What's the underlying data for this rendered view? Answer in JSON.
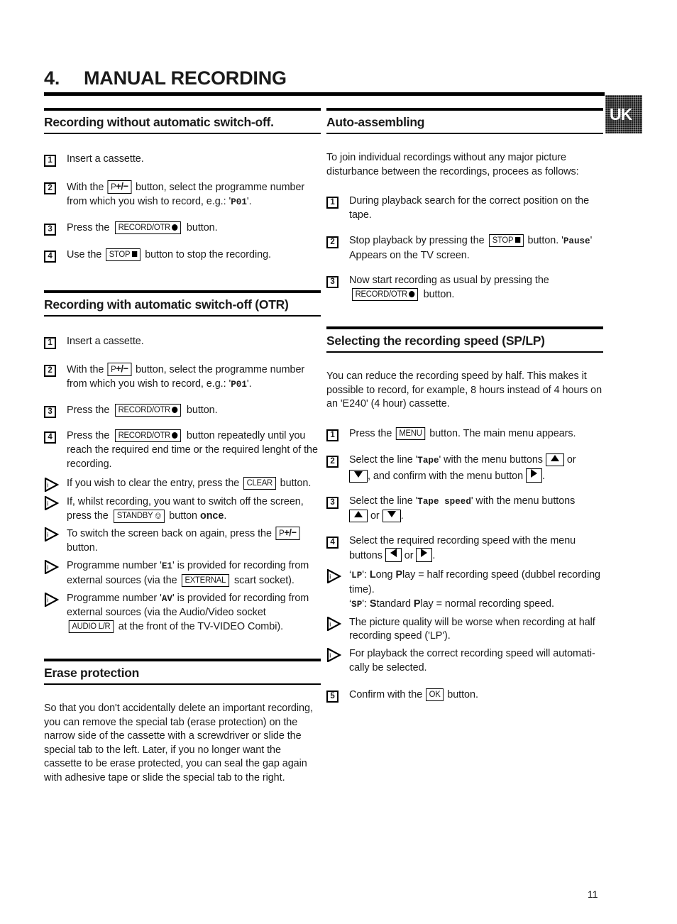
{
  "chapter": {
    "number": "4.",
    "title": "MANUAL RECORDING"
  },
  "badge": {
    "label": "UK"
  },
  "page_number": "11",
  "left_column": {
    "sections": [
      {
        "title": "Recording without automatic switch-off.",
        "steps": [
          {
            "marker": "1",
            "text": "Insert a cassette."
          },
          {
            "marker": "2",
            "text": "With the [P+/−] button, select the programme number from which you wish to record, e.g.: 'P01'."
          },
          {
            "marker": "3",
            "text": "Press the [RECORD/OTR ●] button."
          },
          {
            "marker": "4",
            "text": "Use the [STOP ■] button to stop the recording."
          }
        ]
      },
      {
        "title": "Recording with automatic switch-off (OTR)",
        "steps": [
          {
            "marker": "1",
            "text": "Insert a cassette."
          },
          {
            "marker": "2",
            "text": "With the [P+/−] button, select the programme number from which you wish to record, e.g.: 'P01'."
          },
          {
            "marker": "3",
            "text": "Press the [RECORD/OTR ●] button."
          },
          {
            "marker": "4",
            "text": "Press the [RECORD/OTR ●] button repeatedly until you reach the required end time or the required lenght of the recording."
          },
          {
            "marker": "info",
            "text": "If you wish to clear the entry, press the [CLEAR] button."
          },
          {
            "marker": "info",
            "text": "If, whilst recording, you want to switch off the screen, press the [STANDBY ⏻] button once ."
          },
          {
            "marker": "info",
            "text": "To switch the screen back on again, press the [P+/−] button."
          },
          {
            "marker": "info",
            "text": "Programme number 'E1' is provided for recording from external sources (via the [EXTERNAL] scart socket)."
          },
          {
            "marker": "info",
            "text": "Programme number 'AV' is provided for recording from external sources (via the Audio/Video socket [AUDIO L/R] at the front of the TV-VIDEO Combi)."
          }
        ]
      },
      {
        "title": "Erase protection",
        "paragraph": "So that you don't accidentally delete an important recording, you can remove the special tab (erase protection) on the narrow side of the cassette with a screwdriver or slide the special tab to the left. Later, if you no longer want the cassette to be erase protected, you can seal the gap again with adhesive tape or slide the special tab to the right."
      }
    ]
  },
  "right_column": {
    "sections": [
      {
        "title": "Auto-assembling",
        "paragraph": "To join individual recordings without any major picture disturbance between the recordings, procees as follows:",
        "steps": [
          {
            "marker": "1",
            "text": "During playback search for the correct position on the tape."
          },
          {
            "marker": "2",
            "text": "Stop playback by pressing the [STOP ■] button. 'Pause' Appears on the TV screen."
          },
          {
            "marker": "3",
            "text": "Now start recording as usual by pressing the [RECORD/OTR ●] button."
          }
        ]
      },
      {
        "title": "Selecting the recording speed (SP/LP)",
        "paragraph": "You can reduce the recording speed by half. This makes it possible to record, for example, 8 hours instead of 4 hours on an 'E240' (4 hour) cassette.",
        "steps": [
          {
            "marker": "1",
            "text": "Press the [MENU] button. The main menu appears."
          },
          {
            "marker": "2",
            "text": "Select the line 'Tape' with the menu buttons [▲] or [▼] , and confirm with the menu button [▶] ."
          },
          {
            "marker": "3",
            "text": "Select the line 'Tape speed' with the menu buttons [▲] or [▼] ."
          },
          {
            "marker": "4",
            "text": "Select the required recording speed with the menu buttons [◀] or [▶] ."
          },
          {
            "marker": "info",
            "text": "'LP': Long Play = half recording speed (dubbel recording time). 'SP': Standard Play = normal recording speed."
          },
          {
            "marker": "info",
            "text": "The picture quality will be worse when recording at half recording speed ('LP')."
          },
          {
            "marker": "info",
            "text": "For playback the correct recording speed will automatically be selected."
          },
          {
            "marker": "5",
            "text": "Confirm with the [OK] button."
          }
        ]
      }
    ]
  },
  "labels": {
    "p_plus_minus_prefix": "P",
    "p_plus_minus_suffix": "+/−",
    "record_otr": "RECORD/OTR",
    "stop": "STOP",
    "clear": "CLEAR",
    "standby": "STANDBY",
    "external": "EXTERNAL",
    "audio_lr": "AUDIO L/R",
    "menu": "MENU",
    "ok": "OK",
    "tape": "Tape",
    "tape_speed": "Tape speed",
    "pause": "Pause",
    "p01": "P01",
    "e1": "E1",
    "av": "AV",
    "lp": "LP",
    "sp": "SP",
    "once": "once",
    "e240": "'E240'",
    "lp_quoted": "('LP')"
  },
  "text_fragments": {
    "l1_s1": "Insert a cassette.",
    "l1_s2_a": "With the",
    "l1_s2_b": "button, select the programme number",
    "l1_s2_c": "from which you wish to record, e.g.: '",
    "l1_s2_d": "'.",
    "l1_s3_a": "Press the",
    "l1_s3_b": "button.",
    "l1_s4_a": "Use the",
    "l1_s4_b": "button to stop the recording.",
    "l2_s4_a": "Press the",
    "l2_s4_b": "button repeatedly until you",
    "l2_s4_c": "reach the required end time or the required lenght of the",
    "l2_s4_d": "recording.",
    "l2_i1_a": "If you wish to clear the entry, press the",
    "l2_i1_b": "button.",
    "l2_i2_a": "If, whilst recording, you want to switch off the screen,",
    "l2_i2_b": "press the",
    "l2_i2_c": "button",
    "l2_i2_d": ".",
    "l2_i3_a": "To switch the screen back on again, press the",
    "l2_i3_b": "button.",
    "l2_i4_a": "Programme number '",
    "l2_i4_b": "' is provided for recording from",
    "l2_i4_c": "external sources (via the",
    "l2_i4_d": "scart socket).",
    "l2_i5_a": "Programme number '",
    "l2_i5_b": "' is provided for recording from",
    "l2_i5_c": "external sources (via the Audio/Video socket",
    "l2_i5_d": "at the front of the TV-VIDEO Combi).",
    "r1_p": "To join individual recordings without any major picture disturbance between the recordings, procees as follows:",
    "r1_s1": "During playback search for the correct position on the tape.",
    "r1_s2_a": "Stop playback by pressing the",
    "r1_s2_b": "button. '",
    "r1_s2_c": "'",
    "r1_s2_d": "Appears on the TV screen.",
    "r1_s3_a": "Now start recording as usual by pressing the",
    "r1_s3_b": "button.",
    "r2_p": "You can reduce the recording speed by half. This makes it possible to record, for example, 8 hours instead of 4 hours on an 'E240' (4 hour) cassette.",
    "r2_s1_a": "Press the",
    "r2_s1_b": "button. The main menu appears.",
    "r2_s2_a": "Select the line '",
    "r2_s2_b": "' with the menu buttons",
    "r2_s2_c": "or",
    "r2_s2_d": ", and confirm with the menu button",
    "r2_s2_e": ".",
    "r2_s3_a": "Select the line '",
    "r2_s3_b": "' with the menu buttons",
    "r2_s3_c": "or",
    "r2_s3_d": ".",
    "r2_s4_a": "Select the required recording speed with the menu",
    "r2_s4_b": "buttons",
    "r2_s4_c": "or",
    "r2_s4_d": ".",
    "r2_i1_a": "': ",
    "r2_i1_b": "ong ",
    "r2_i1_c": "lay = half recording speed (dubbel recording",
    "r2_i1_d": "time).",
    "r2_i1_e": "': ",
    "r2_i1_f": "tandard ",
    "r2_i1_g": "lay = normal recording speed.",
    "r2_i2_a": "The picture quality will be worse when recording at half",
    "r2_i2_b": "recording speed ('LP').",
    "r2_i3_a": "For playback the correct recording speed will automati-",
    "r2_i3_b": "cally be selected.",
    "r2_s5_a": "Confirm with the",
    "r2_s5_b": "button."
  }
}
